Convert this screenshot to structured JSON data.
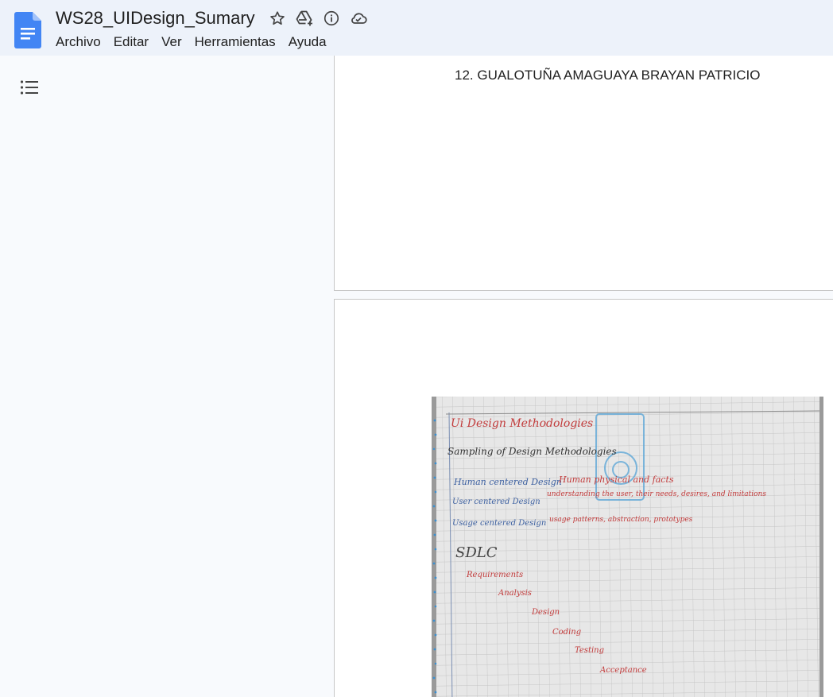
{
  "header": {
    "doc_title": "WS28_UIDesign_Sumary",
    "title_icons": [
      "star-icon",
      "move-to-drive-icon",
      "info-icon",
      "cloud-saved-icon"
    ],
    "menu": [
      "Archivo",
      "Editar",
      "Ver",
      "Herramientas",
      "Ayuda"
    ]
  },
  "sidebar": {
    "outline_icon": "outline-list-icon"
  },
  "document": {
    "page1_text": "12. GUALOTUÑA AMAGUAYA BRAYAN PATRICIO",
    "photo_notes": {
      "heading": "Ui Design Methodologies",
      "subheading": "Sampling of Design Methodologies",
      "lines": [
        {
          "left": "Human centered Design",
          "right": "Human physical and facts"
        },
        {
          "left": "User centered Design",
          "right": "understanding the user, their needs, desires, and limitations"
        },
        {
          "left": "Usage centered Design",
          "right": "usage patterns, abstraction, prototypes"
        }
      ],
      "sdlc_title": "SDLC",
      "sdlc_steps": [
        "Requirements",
        "Analysis",
        "Design",
        "Coding",
        "Testing",
        "Acceptance"
      ]
    }
  },
  "colors": {
    "topbar_bg": "#edf2fa",
    "page_bg": "#f8fafd",
    "doc_icon_blue": "#4285f4",
    "ink_red": "#c23b3b",
    "ink_blue": "#3b5fa0"
  }
}
